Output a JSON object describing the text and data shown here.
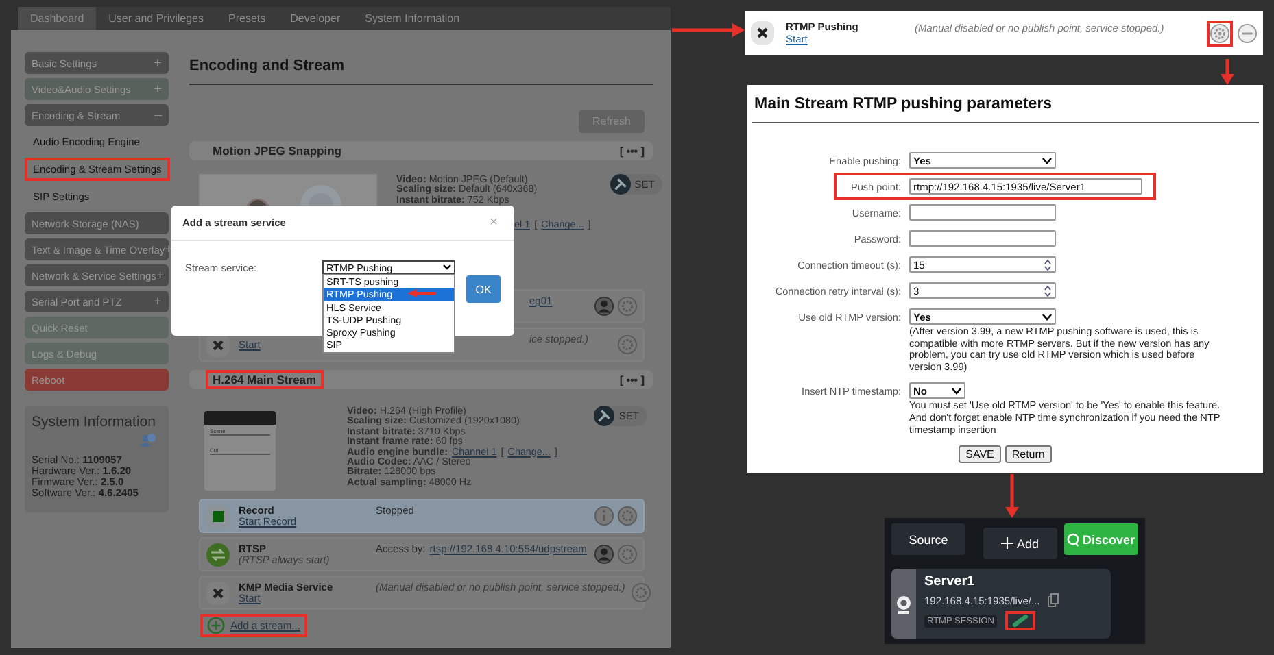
{
  "dashboard": {
    "tabs": [
      {
        "label": "Dashboard",
        "selected": true
      },
      {
        "label": "User and Privileges",
        "selected": false
      },
      {
        "label": "Presets",
        "selected": false
      },
      {
        "label": "Developer",
        "selected": false
      },
      {
        "label": "System Information",
        "selected": false
      }
    ],
    "sidebar": {
      "items": [
        {
          "label": "Basic Settings",
          "toggle": "+",
          "color": "#4d4d4d"
        },
        {
          "label": "Video&Audio Settings",
          "toggle": "+",
          "color": "#58615b"
        },
        {
          "label": "Encoding & Stream",
          "toggle": "–",
          "color": "#4d4d4d",
          "children": [
            {
              "label": "Audio Encoding Engine",
              "highlighted": false
            },
            {
              "label": "Encoding & Stream Settings",
              "highlighted": true
            },
            {
              "label": "SIP Settings",
              "highlighted": false
            }
          ]
        },
        {
          "label": "Network Storage (NAS)",
          "color": "#4d4d4d"
        },
        {
          "label": "Text & Image & Time Overlay",
          "toggle": "+",
          "color": "#4d4d4d"
        },
        {
          "label": "Network & Service Settings",
          "toggle": "+",
          "color": "#4d4d4d"
        },
        {
          "label": "Serial Port and PTZ",
          "toggle": "+",
          "color": "#4d4d4d"
        },
        {
          "label": "Quick Reset",
          "color": "#5e6a61"
        },
        {
          "label": "Logs & Debug",
          "color": "#5e6a61"
        },
        {
          "label": "Reboot",
          "color": "#8a3a35"
        }
      ]
    },
    "system_info": {
      "title": "System Information",
      "rows": [
        "Serial No.: **1109057**",
        "Hardware Ver.: **1.6.20**",
        "Firmware Ver.: **2.5.0**",
        "Software Ver.: **4.6.2405**"
      ]
    },
    "content": {
      "title": "Encoding and Stream",
      "refresh": "Refresh",
      "sections": [
        {
          "kind": "snapshot",
          "title": "Motion JPEG Snapping",
          "highlighted": false,
          "menu": "[ ••• ]",
          "set": "SET",
          "info": [
            {
              "kind": "full",
              "parts": [
                {
                  "kind": "text",
                  "text": "**Video:** Motion JPEG (Default)"
                }
              ]
            },
            {
              "kind": "full",
              "parts": [
                {
                  "kind": "text",
                  "text": "**Scaling size:** Default (640x368)"
                }
              ]
            },
            {
              "kind": "full",
              "parts": [
                {
                  "kind": "text",
                  "text": "**Instant bitrate:** 752 Kbps"
                }
              ]
            },
            {
              "kind": "partial",
              "parts": [
                {
                  "kind": "link",
                  "text": "el 1"
                },
                {
                  "kind": "text",
                  "text": "["
                },
                {
                  "kind": "link",
                  "text": "Change..."
                },
                {
                  "kind": "text",
                  "text": "]"
                }
              ]
            }
          ],
          "services": [
            {
              "kind": "access",
              "covered": true,
              "hovered": false,
              "status": [
                {
                  "kind": "link",
                  "text": "eg01"
                }
              ]
            },
            {
              "kind": "stopped",
              "covered": true,
              "hovered": false,
              "link": "Start",
              "status": [
                {
                  "kind": "note",
                  "text": "ice stopped.)"
                }
              ]
            }
          ]
        },
        {
          "kind": "video",
          "title": "H.264 Main Stream",
          "highlighted": true,
          "menu": "[ ••• ]",
          "clapper_labels": [
            "Scene",
            "Cut"
          ],
          "set": "SET",
          "info": [
            {
              "kind": "full",
              "parts": [
                {
                  "kind": "text",
                  "text": "**Video:** H.264 (High Profile)"
                }
              ]
            },
            {
              "kind": "full",
              "parts": [
                {
                  "kind": "text",
                  "text": "**Scaling size:** Customized (1920x1080)"
                }
              ]
            },
            {
              "kind": "full",
              "parts": [
                {
                  "kind": "text",
                  "text": "**Instant bitrate:** 3710 Kbps"
                }
              ]
            },
            {
              "kind": "full",
              "parts": [
                {
                  "kind": "text",
                  "text": "**Instant frame rate:** 60 fps"
                }
              ]
            },
            {
              "kind": "full",
              "parts": [
                {
                  "kind": "text",
                  "text": "**Audio engine bundle:**"
                },
                {
                  "kind": "link",
                  "text": "Channel 1"
                },
                {
                  "kind": "text",
                  "text": "["
                },
                {
                  "kind": "link",
                  "text": "Change..."
                },
                {
                  "kind": "text",
                  "text": "]"
                }
              ]
            },
            {
              "kind": "full",
              "parts": [
                {
                  "kind": "text",
                  "text": "**Audio Codec:** AAC / Stereo"
                }
              ]
            },
            {
              "kind": "full",
              "parts": [
                {
                  "kind": "text",
                  "text": "**Bitrate:** 128000 bps"
                }
              ]
            },
            {
              "kind": "full",
              "parts": [
                {
                  "kind": "text",
                  "text": "**Actual sampling:** 48000 Hz"
                }
              ]
            }
          ],
          "services": [
            {
              "kind": "record",
              "covered": false,
              "hovered": true,
              "name": "Record",
              "link": "Start Record",
              "status": [
                {
                  "kind": "text",
                  "text": "Stopped"
                }
              ]
            },
            {
              "kind": "access",
              "covered": false,
              "hovered": false,
              "name": "RTSP",
              "note": "(RTSP always start)",
              "status": [
                {
                  "kind": "text",
                  "text": "Access by:"
                },
                {
                  "kind": "link",
                  "text": "rtsp://192.168.4.10:554/udpstream"
                }
              ]
            },
            {
              "kind": "stopped",
              "covered": false,
              "hovered": false,
              "name": "KMP Media Service",
              "link": "Start",
              "status": [
                {
                  "kind": "note",
                  "text": "(Manual disabled or no publish point, service stopped.)"
                }
              ]
            }
          ]
        }
      ],
      "add_stream": {
        "label": "Add a stream...",
        "highlighted": true
      }
    },
    "dialog": {
      "title": "Add a stream service",
      "close": "×",
      "label": "Stream service:",
      "value": "RTMP Pushing",
      "ok": "OK",
      "options": [
        {
          "label": "SRT-TS pushing",
          "selected": false
        },
        {
          "label": "RTMP Pushing",
          "selected": true
        },
        {
          "label": "HLS Service",
          "selected": false
        },
        {
          "label": "TS-UDP Pushing",
          "selected": false
        },
        {
          "label": "Sproxy Pushing",
          "selected": false
        },
        {
          "label": "SIP",
          "selected": false
        }
      ]
    }
  },
  "service_row": {
    "name": "RTMP Pushing",
    "link": "Start",
    "status": "(Manual disabled or no publish point, service stopped.)",
    "gear_highlighted": true
  },
  "parameters": {
    "title": "Main Stream RTMP pushing parameters",
    "fields": [
      {
        "label": "Enable pushing:",
        "kind": "select",
        "value": "Yes",
        "highlighted": false
      },
      {
        "label": "Push point:",
        "kind": "text-wide",
        "value": "rtmp://192.168.4.15:1935/live/Server1",
        "highlighted": true
      },
      {
        "label": "Username:",
        "kind": "text",
        "highlighted": false
      },
      {
        "label": "Password:",
        "kind": "text",
        "highlighted": false
      },
      {
        "label": "Connection timeout (s):",
        "kind": "number",
        "value": "15",
        "highlighted": false
      },
      {
        "label": "Connection retry interval (s):",
        "kind": "number",
        "value": "3",
        "highlighted": false
      },
      {
        "label": "Use old RTMP version:",
        "kind": "select",
        "value": "Yes",
        "highlighted": false,
        "note": "(After version 3.99, a new RTMP pushing software is used, this is compatible with more RTMP servers. But if the new version has any problem, you can try use old RTMP version which is used before version 3.99)"
      },
      {
        "label": "Insert NTP timestamp:",
        "kind": "select-short",
        "value": "No",
        "highlighted": false,
        "note": "You must set 'Use old RTMP version' to be 'Yes' to enable this feature. And don't forget enable NTP time synchronization if you need the NTP timestamp insertion"
      }
    ],
    "buttons": [
      "SAVE",
      "Return"
    ]
  },
  "app": {
    "buttons": [
      {
        "label": "Source",
        "kind": "plain"
      },
      {
        "label": "Add",
        "kind": "add"
      },
      {
        "label": "Discover",
        "kind": "discover"
      }
    ],
    "card": {
      "name": "Server1",
      "address": "192.168.4.15:1935/live/...",
      "badge": "RTMP SESSION",
      "link_highlighted": true
    }
  }
}
